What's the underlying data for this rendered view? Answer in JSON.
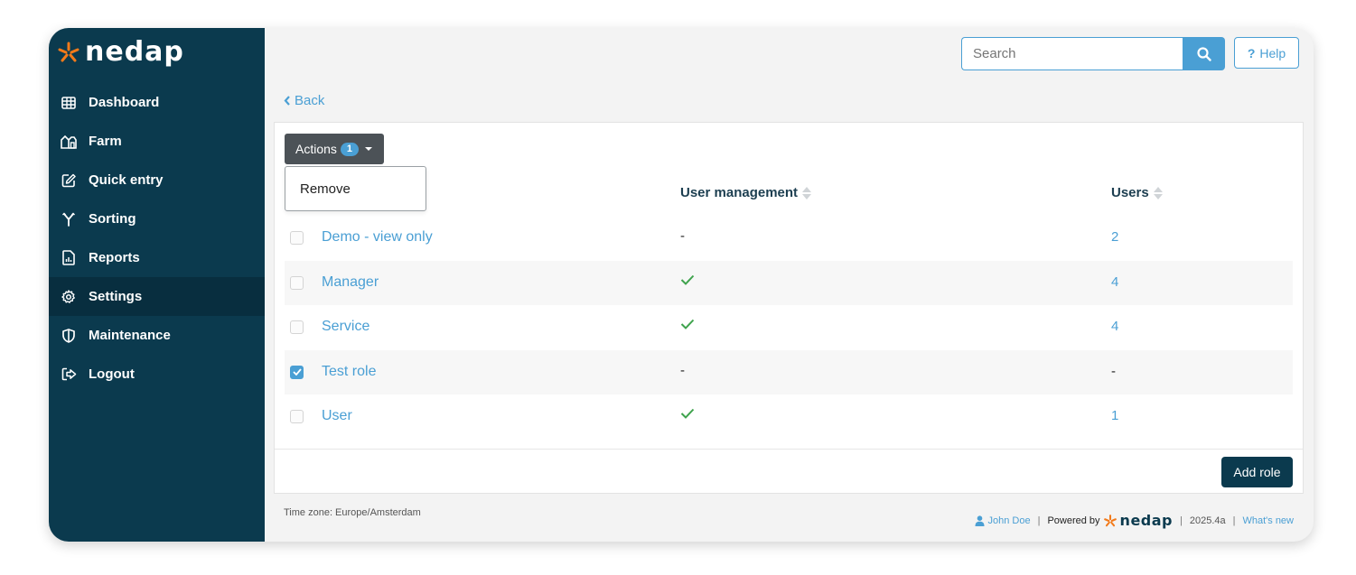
{
  "brand": {
    "logo_text": "nedap",
    "accent_color": "#f27a1a"
  },
  "sidebar": {
    "items": [
      {
        "label": "Dashboard",
        "icon": "grid-icon"
      },
      {
        "label": "Farm",
        "icon": "farm-icon"
      },
      {
        "label": "Quick entry",
        "icon": "edit-icon"
      },
      {
        "label": "Sorting",
        "icon": "sorting-icon"
      },
      {
        "label": "Reports",
        "icon": "report-icon"
      },
      {
        "label": "Settings",
        "icon": "gear-icon",
        "active": true
      },
      {
        "label": "Maintenance",
        "icon": "shield-icon"
      },
      {
        "label": "Logout",
        "icon": "logout-icon"
      }
    ]
  },
  "header": {
    "search_placeholder": "Search",
    "help_label": "Help",
    "help_mark": "?"
  },
  "back_label": "Back",
  "actions": {
    "label": "Actions",
    "count": "1",
    "dropdown_item": "Remove"
  },
  "table": {
    "col_user_management": "User management",
    "col_users": "Users",
    "rows": [
      {
        "name": "Demo - view only",
        "management": "-",
        "users": "2",
        "checked": false
      },
      {
        "name": "Manager",
        "management": "check",
        "users": "4",
        "checked": false
      },
      {
        "name": "Service",
        "management": "check",
        "users": "4",
        "checked": false
      },
      {
        "name": "Test role",
        "management": "-",
        "users": "-",
        "checked": true
      },
      {
        "name": "User",
        "management": "check",
        "users": "1",
        "checked": false
      }
    ]
  },
  "add_role_label": "Add role",
  "footer": {
    "timezone": "Time zone: Europe/Amsterdam",
    "user": "John Doe",
    "powered_by": "Powered by",
    "powered_brand": "nedap",
    "version": "2025.4a",
    "whats_new": "What's new",
    "separator": "|"
  },
  "colors": {
    "sidebar": "#0b3a4e",
    "link": "#4a9fd4",
    "check": "#3fa34d"
  }
}
